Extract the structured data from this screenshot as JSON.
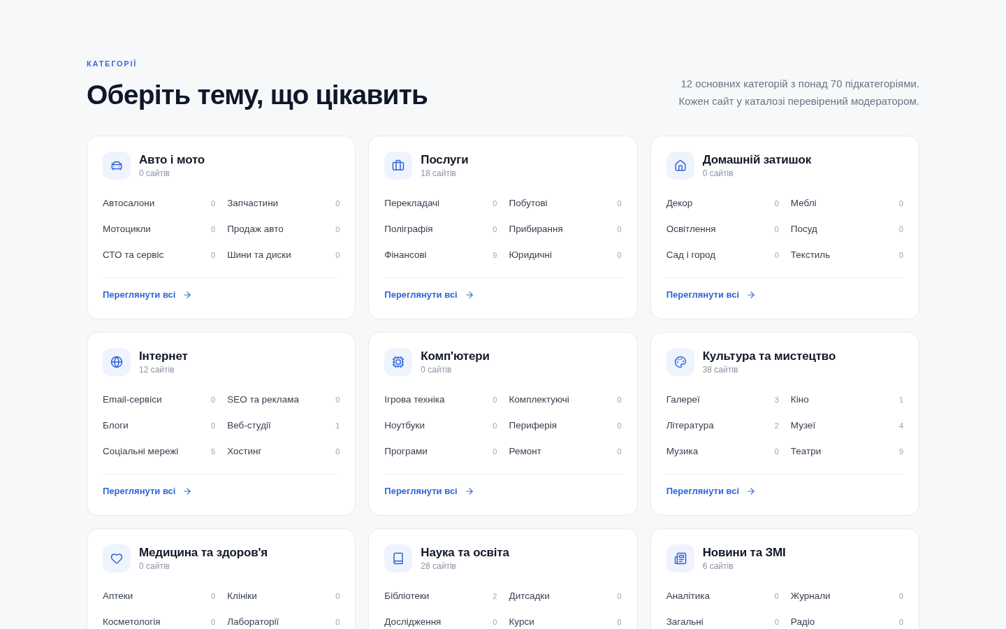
{
  "header": {
    "eyebrow": "КАТЕГОРІЇ",
    "title": "Оберіть тему, що цікавить",
    "description": "12 основних категорій з понад 70 підкатегоріями. Кожен сайт у каталозі перевірений модератором."
  },
  "categories": [
    {
      "title": "Авто і мото",
      "count": "0 сайтів",
      "subcategories": [
        {
          "name": "Автосалони",
          "count": "0"
        },
        {
          "name": "Запчастини",
          "count": "0"
        },
        {
          "name": "Мотоцикли",
          "count": "0"
        },
        {
          "name": "Продаж авто",
          "count": "0"
        },
        {
          "name": "СТО та сервіс",
          "count": "0"
        },
        {
          "name": "Шини та диски",
          "count": "0"
        }
      ],
      "link": "Переглянути всі"
    },
    {
      "title": "Послуги",
      "count": "18 сайтів",
      "subcategories": [
        {
          "name": "Перекладачі",
          "count": "0"
        },
        {
          "name": "Побутові",
          "count": "0"
        },
        {
          "name": "Поліграфія",
          "count": "0"
        },
        {
          "name": "Прибирання",
          "count": "0"
        },
        {
          "name": "Фінансові",
          "count": "9"
        },
        {
          "name": "Юридичні",
          "count": "0"
        }
      ],
      "link": "Переглянути всі"
    },
    {
      "title": "Домашній затишок",
      "count": "0 сайтів",
      "subcategories": [
        {
          "name": "Декор",
          "count": "0"
        },
        {
          "name": "Меблі",
          "count": "0"
        },
        {
          "name": "Освітлення",
          "count": "0"
        },
        {
          "name": "Посуд",
          "count": "0"
        },
        {
          "name": "Сад і город",
          "count": "0"
        },
        {
          "name": "Текстиль",
          "count": "0"
        }
      ],
      "link": "Переглянути всі"
    },
    {
      "title": "Інтернет",
      "count": "12 сайтів",
      "subcategories": [
        {
          "name": "Email-сервіси",
          "count": "0"
        },
        {
          "name": "SEO та реклама",
          "count": "0"
        },
        {
          "name": "Блоги",
          "count": "0"
        },
        {
          "name": "Веб-студії",
          "count": "1"
        },
        {
          "name": "Соціальні мережі",
          "count": "5"
        },
        {
          "name": "Хостинг",
          "count": "0"
        }
      ],
      "link": "Переглянути всі"
    },
    {
      "title": "Комп'ютери",
      "count": "0 сайтів",
      "subcategories": [
        {
          "name": "Ігрова техніка",
          "count": "0"
        },
        {
          "name": "Комплектуючі",
          "count": "0"
        },
        {
          "name": "Ноутбуки",
          "count": "0"
        },
        {
          "name": "Периферія",
          "count": "0"
        },
        {
          "name": "Програми",
          "count": "0"
        },
        {
          "name": "Ремонт",
          "count": "0"
        }
      ],
      "link": "Переглянути всі"
    },
    {
      "title": "Культура та мистецтво",
      "count": "38 сайтів",
      "subcategories": [
        {
          "name": "Галереї",
          "count": "3"
        },
        {
          "name": "Кіно",
          "count": "1"
        },
        {
          "name": "Література",
          "count": "2"
        },
        {
          "name": "Музеї",
          "count": "4"
        },
        {
          "name": "Музика",
          "count": "0"
        },
        {
          "name": "Театри",
          "count": "9"
        }
      ],
      "link": "Переглянути всі"
    },
    {
      "title": "Медицина та здоров'я",
      "count": "0 сайтів",
      "subcategories": [
        {
          "name": "Аптеки",
          "count": "0"
        },
        {
          "name": "Клініки",
          "count": "0"
        },
        {
          "name": "Косметологія",
          "count": "0"
        },
        {
          "name": "Лабораторії",
          "count": "0"
        }
      ]
    },
    {
      "title": "Наука та освіта",
      "count": "28 сайтів",
      "subcategories": [
        {
          "name": "Бібліотеки",
          "count": "2"
        },
        {
          "name": "Дитсадки",
          "count": "0"
        },
        {
          "name": "Дослідження",
          "count": "0"
        },
        {
          "name": "Курси",
          "count": "0"
        }
      ]
    },
    {
      "title": "Новини та ЗМІ",
      "count": "6 сайтів",
      "subcategories": [
        {
          "name": "Аналітика",
          "count": "0"
        },
        {
          "name": "Журнали",
          "count": "0"
        },
        {
          "name": "Загальні",
          "count": "0"
        },
        {
          "name": "Радіо",
          "count": "0"
        }
      ]
    }
  ]
}
